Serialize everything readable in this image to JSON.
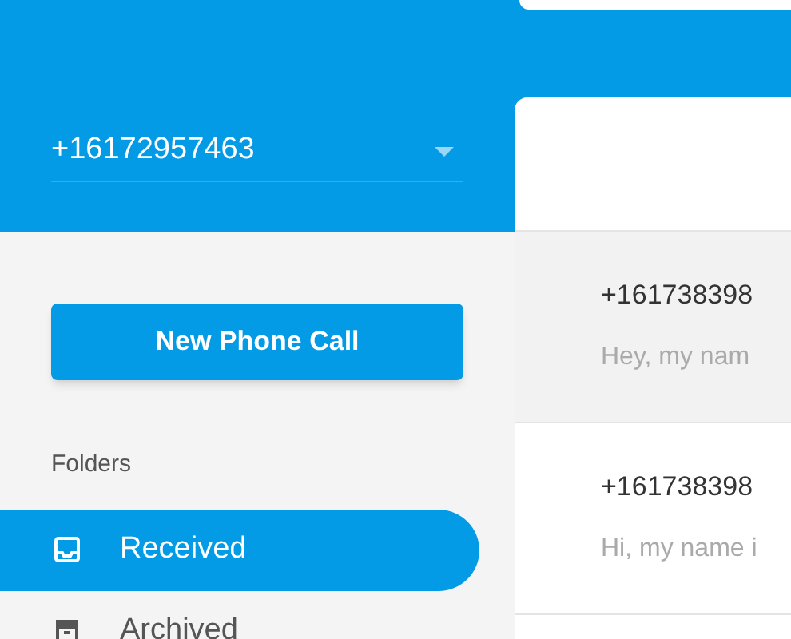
{
  "phone_select": {
    "value": "+16172957463"
  },
  "new_call_button": {
    "label": "New Phone Call"
  },
  "folders": {
    "heading": "Folders",
    "items": [
      {
        "label": "Received",
        "kind": "inbox",
        "selected": true
      },
      {
        "label": "Archived",
        "kind": "archive",
        "selected": false
      }
    ]
  },
  "messages": [
    {
      "number": "+161738398",
      "preview": "Hey, my nam",
      "selected": true
    },
    {
      "number": "+161738398",
      "preview": "Hi, my name i",
      "selected": false
    }
  ]
}
